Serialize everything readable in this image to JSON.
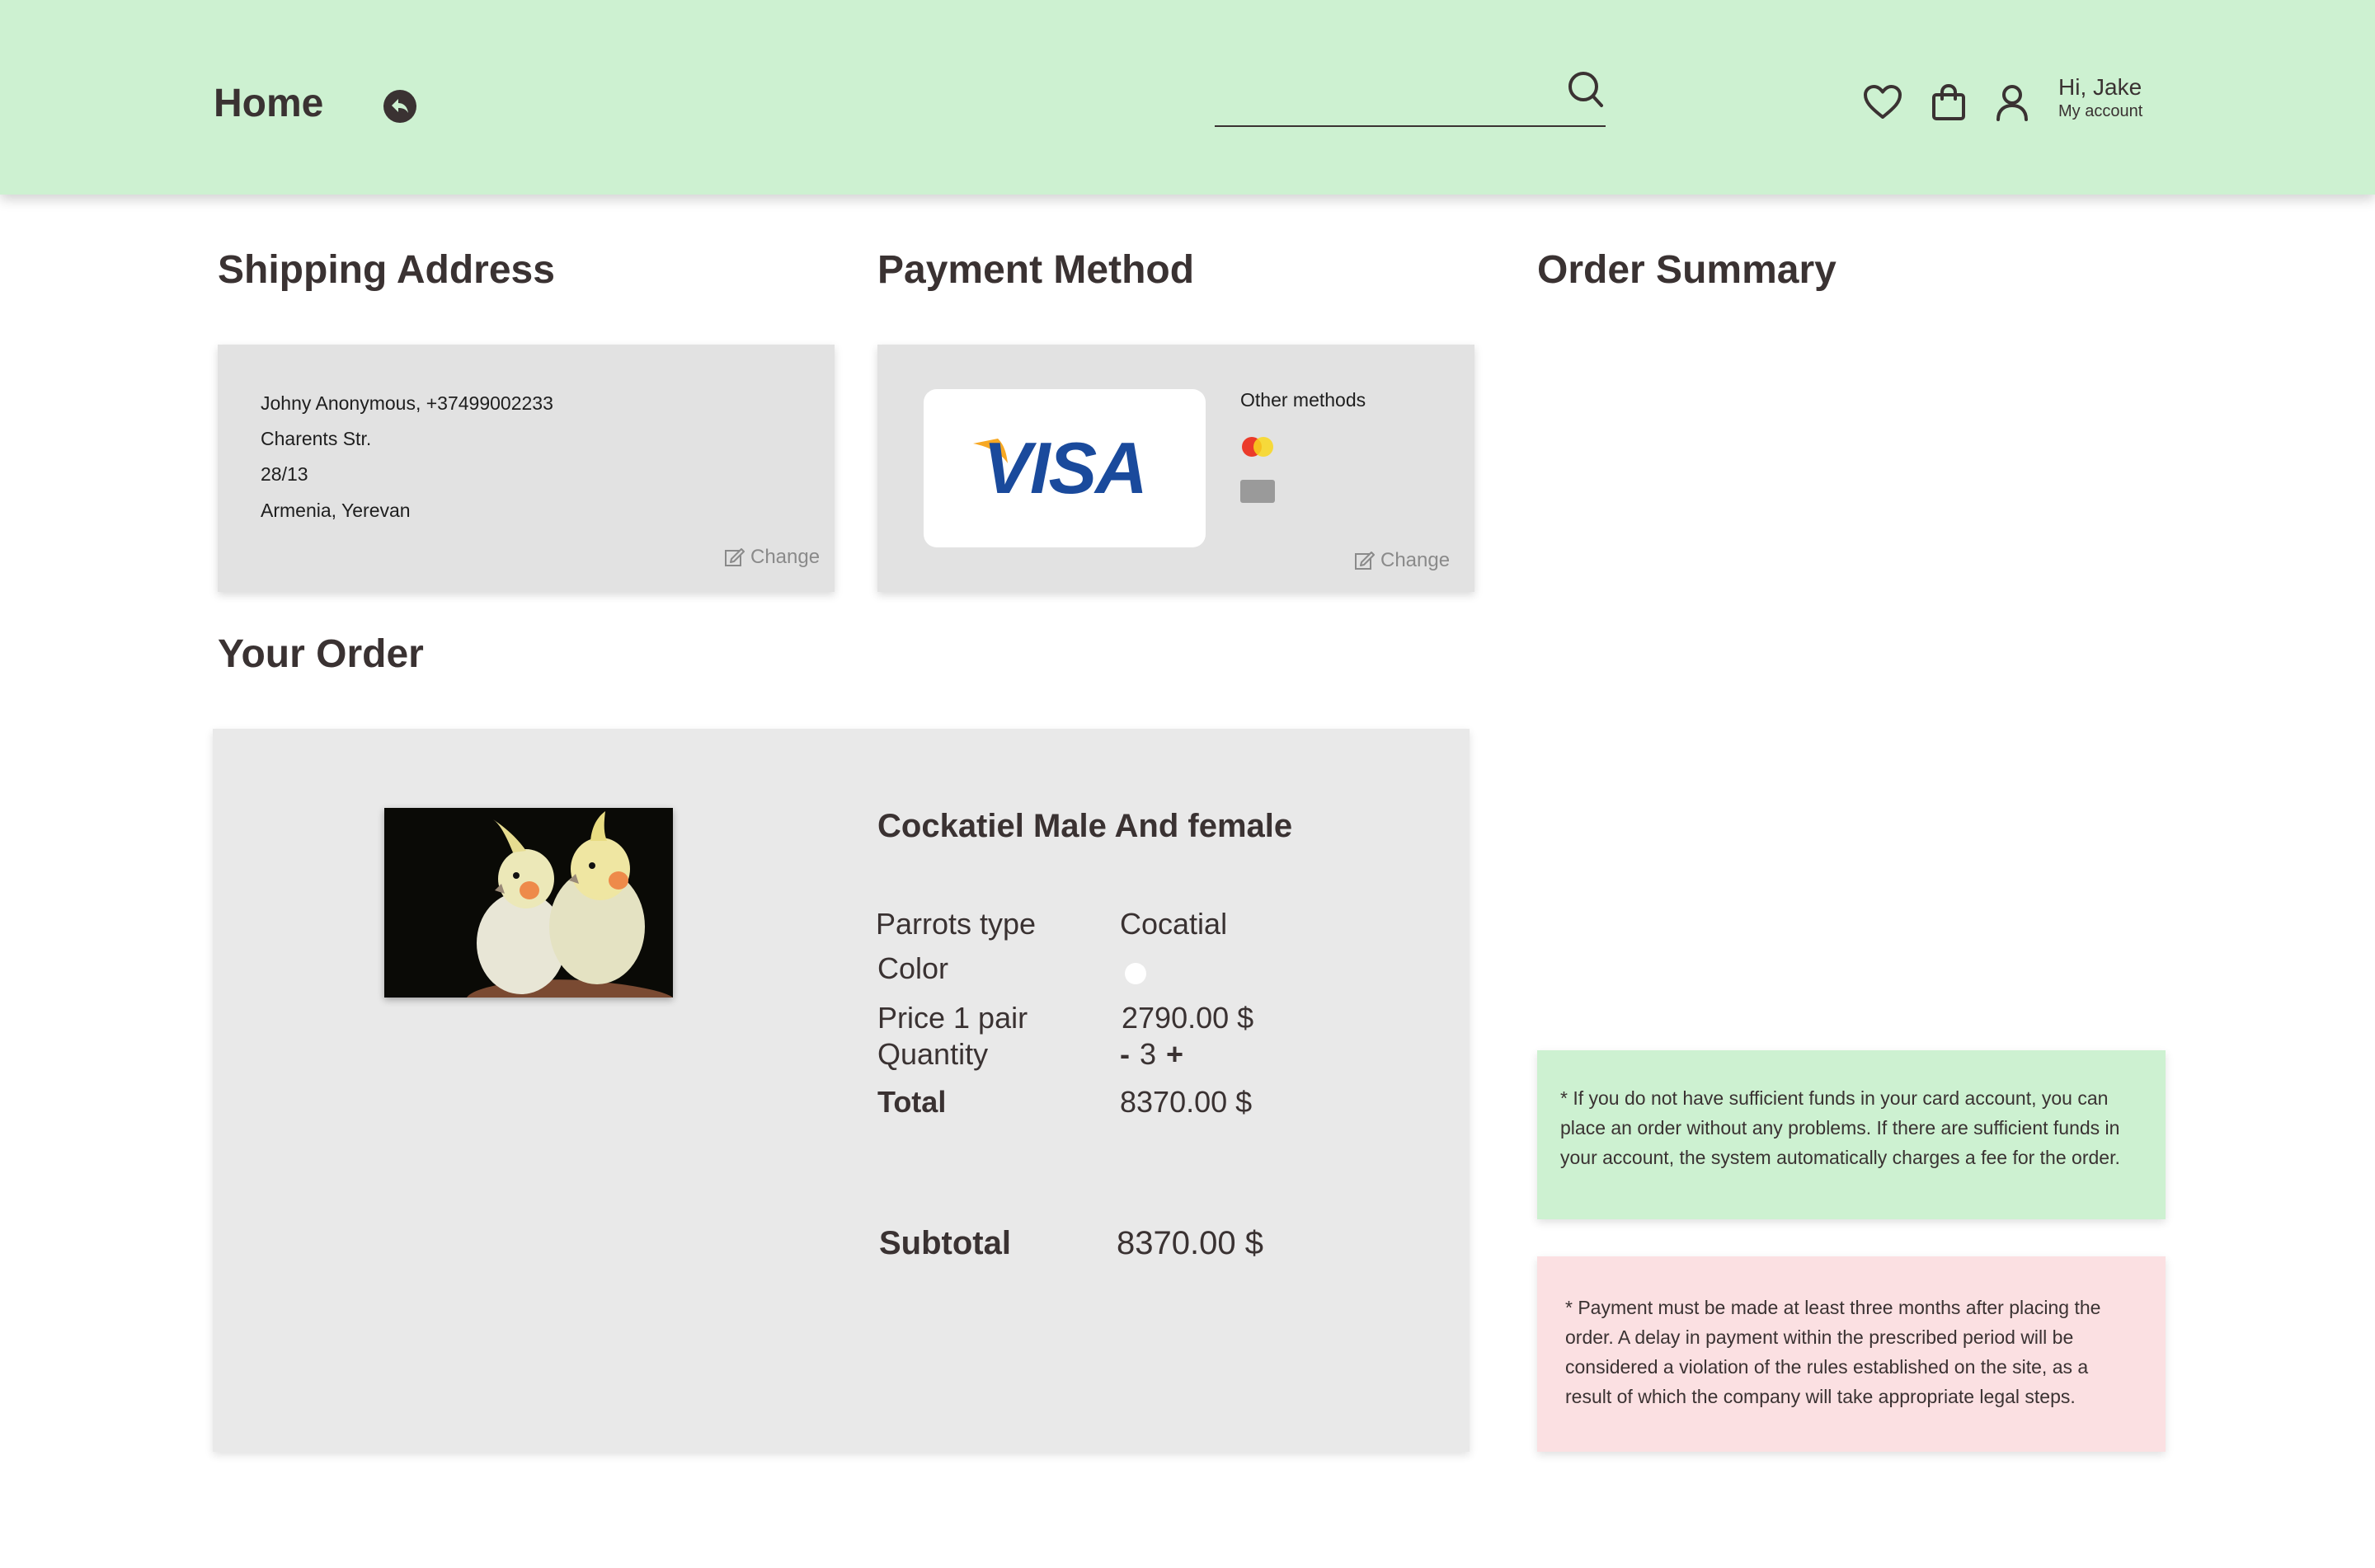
{
  "header": {
    "title": "Home",
    "search_placeholder": "",
    "greeting": "Hi, Jake",
    "account_link": "My account"
  },
  "sections": {
    "shipping_title": "Shipping Address",
    "payment_title": "Payment Method",
    "summary_title": "Order Summary",
    "order_title": "Your Order"
  },
  "shipping": {
    "lines": [
      "Johny Anonymous, +37499002233",
      "Charents Str.",
      "28/13",
      "Armenia, Yerevan"
    ],
    "change_label": "Change"
  },
  "payment": {
    "card_brand": "VISA",
    "other_label": "Other methods",
    "change_label": "Change"
  },
  "order": {
    "product_name": "Cockatiel Male And female",
    "type_label": "Parrots type",
    "type_value": "Cocatial",
    "color_label": "Color",
    "color_value": "#ffffff",
    "price_label": "Price 1 pair",
    "price_value": "2790.00 $",
    "quantity_label": "Quantity",
    "quantity_minus": "-",
    "quantity_value": "3",
    "quantity_plus": "+",
    "total_label": "Total",
    "total_value": "8370.00 $",
    "subtotal_label": "Subtotal",
    "subtotal_value": "8370.00 $"
  },
  "notes": {
    "funds": "* If you do not have sufficient funds in your card account, you can place an order without any problems. If there are sufficient funds in your account, the system automatically charges a fee for the order.",
    "payment": "* Payment must be made at least three months after placing the order. A delay in payment within the prescribed period will be considered a violation of the rules established on the site, as a result of which the company will take appropriate legal steps."
  },
  "colors": {
    "header_bg": "#cdf1d1",
    "text": "#3a3232",
    "note_green": "#cdf1d1",
    "note_pink": "#fbe0e2",
    "visa_blue": "#1a4a9c",
    "visa_gold": "#f7a823"
  }
}
